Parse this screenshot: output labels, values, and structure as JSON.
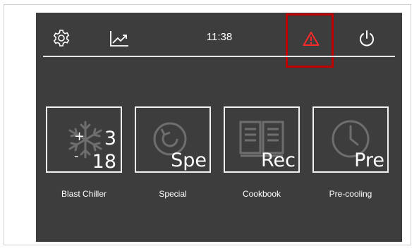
{
  "topbar": {
    "clock": "11:38",
    "icons": {
      "settings": "gear-icon",
      "stats": "chart-trend-icon",
      "alert": "warning-triangle-icon",
      "power": "power-icon"
    },
    "alert_color": "#ff2a2a",
    "highlight_color": "#c00000"
  },
  "tiles": [
    {
      "code": "",
      "label": "Blast Chiller",
      "icon": "snowflake-icon",
      "temp_high": "3",
      "temp_low": "18",
      "plus": "+",
      "minus": "-"
    },
    {
      "code": "Spe",
      "label": "Special",
      "icon": "refresh-cycle-icon"
    },
    {
      "code": "Rec",
      "label": "Cookbook",
      "icon": "book-icon"
    },
    {
      "code": "Pre",
      "label": "Pre-cooling",
      "icon": "clock-icon"
    }
  ],
  "colors": {
    "screen_bg": "#3d3d3d",
    "text": "#ffffff",
    "tile_border": "#f2f2f2",
    "icon_faded": "#6e6e6e"
  }
}
